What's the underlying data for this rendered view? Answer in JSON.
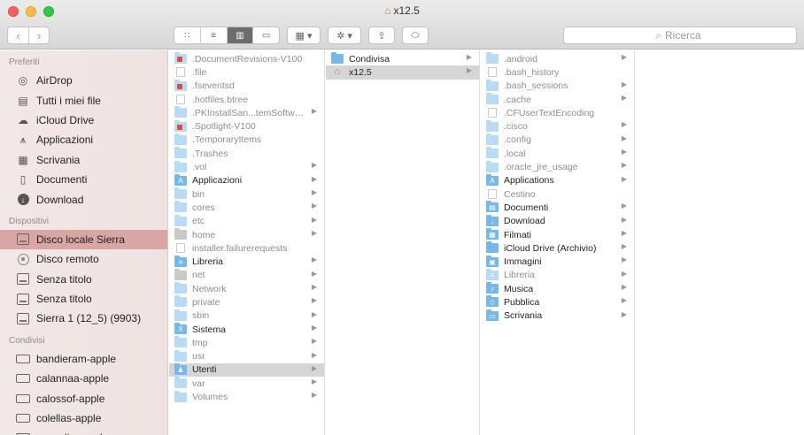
{
  "window": {
    "title": "x12.5",
    "title_icon": "home-icon"
  },
  "toolbar": {
    "back_glyph": "‹",
    "forward_glyph": "›",
    "view_icons": [
      "icon-view-icon",
      "list-view-icon",
      "column-view-icon",
      "cover-flow-icon"
    ],
    "arrange_glyph": "▦ ▾",
    "action_glyph": "✲ ▾",
    "share_glyph": "⇪",
    "tag_glyph": "⌂"
  },
  "search": {
    "placeholder": "Ricerca"
  },
  "sidebar": {
    "favorites_title": "Preferiti",
    "favorites": [
      {
        "label": "AirDrop",
        "icon": "airdrop-icon"
      },
      {
        "label": "Tutti i miei file",
        "icon": "all-files-icon"
      },
      {
        "label": "iCloud Drive",
        "icon": "cloud-icon"
      },
      {
        "label": "Applicazioni",
        "icon": "applications-icon"
      },
      {
        "label": "Scrivania",
        "icon": "desktop-icon"
      },
      {
        "label": "Documenti",
        "icon": "documents-icon"
      },
      {
        "label": "Download",
        "icon": "download-icon"
      }
    ],
    "devices_title": "Dispositivi",
    "devices": [
      {
        "label": "Disco locale Sierra",
        "icon": "disk-icon",
        "selected": true
      },
      {
        "label": "Disco remoto",
        "icon": "optical-disc-icon"
      },
      {
        "label": "Senza titolo",
        "icon": "disk-icon"
      },
      {
        "label": "Senza titolo",
        "icon": "disk-icon"
      },
      {
        "label": "Sierra 1 (12_5) (9903)",
        "icon": "disk-icon"
      }
    ],
    "shared_title": "Condivisi",
    "shared": [
      {
        "label": "bandieram-apple",
        "icon": "computer-icon"
      },
      {
        "label": "calannaa-apple",
        "icon": "computer-icon"
      },
      {
        "label": "calossof-apple",
        "icon": "computer-icon"
      },
      {
        "label": "colellas-apple",
        "icon": "computer-icon"
      },
      {
        "label": "cavaglier-apple",
        "icon": "computer-icon"
      }
    ]
  },
  "columns": {
    "root": [
      {
        "name": ".DocumentRevisions-V100",
        "kind": "badge-red",
        "hidden": true,
        "chev": false
      },
      {
        "name": ".file",
        "kind": "file",
        "hidden": true,
        "chev": false
      },
      {
        "name": ".fseventsd",
        "kind": "badge-red",
        "hidden": true,
        "chev": false
      },
      {
        "name": ".hotfiles.btree",
        "kind": "file",
        "hidden": true,
        "chev": false
      },
      {
        "name": ".PKInstallSan...temSoftware",
        "kind": "pale",
        "hidden": true,
        "chev": true
      },
      {
        "name": ".Spotlight-V100",
        "kind": "badge-red",
        "hidden": true,
        "chev": false
      },
      {
        "name": ".TemporaryItems",
        "kind": "pale",
        "hidden": true,
        "chev": false
      },
      {
        "name": ".Trashes",
        "kind": "pale",
        "hidden": true,
        "chev": false
      },
      {
        "name": ".vol",
        "kind": "pale",
        "hidden": true,
        "chev": true
      },
      {
        "name": "Applicazioni",
        "kind": "folder",
        "hidden": false,
        "chev": true,
        "glyph": "A"
      },
      {
        "name": "bin",
        "kind": "pale",
        "hidden": true,
        "chev": true
      },
      {
        "name": "cores",
        "kind": "pale",
        "hidden": true,
        "chev": true
      },
      {
        "name": "etc",
        "kind": "pale",
        "hidden": true,
        "chev": true
      },
      {
        "name": "home",
        "kind": "home",
        "hidden": true,
        "chev": true
      },
      {
        "name": "installer.failurerequests",
        "kind": "file",
        "hidden": true,
        "chev": false
      },
      {
        "name": "Libreria",
        "kind": "folder",
        "hidden": false,
        "chev": true,
        "glyph": "≡"
      },
      {
        "name": "net",
        "kind": "home",
        "hidden": true,
        "chev": true
      },
      {
        "name": "Network",
        "kind": "pale",
        "hidden": true,
        "chev": true
      },
      {
        "name": "private",
        "kind": "pale",
        "hidden": true,
        "chev": true
      },
      {
        "name": "sbin",
        "kind": "pale",
        "hidden": true,
        "chev": true
      },
      {
        "name": "Sistema",
        "kind": "folder",
        "hidden": false,
        "chev": true,
        "glyph": "X"
      },
      {
        "name": "tmp",
        "kind": "pale",
        "hidden": true,
        "chev": true
      },
      {
        "name": "usr",
        "kind": "pale",
        "hidden": true,
        "chev": true
      },
      {
        "name": "Utenti",
        "kind": "folder",
        "hidden": false,
        "chev": true,
        "glyph": "♟",
        "selected": true
      },
      {
        "name": "var",
        "kind": "pale",
        "hidden": true,
        "chev": true
      },
      {
        "name": "Volumes",
        "kind": "pale",
        "hidden": true,
        "chev": true
      }
    ],
    "users": [
      {
        "name": "Condivisa",
        "kind": "folder",
        "hidden": false,
        "chev": true
      },
      {
        "name": "x12.5",
        "kind": "homeglyph",
        "hidden": false,
        "chev": true,
        "selected": true
      }
    ],
    "home": [
      {
        "name": ".android",
        "kind": "pale",
        "hidden": true,
        "chev": true
      },
      {
        "name": ".bash_history",
        "kind": "file",
        "hidden": true,
        "chev": false
      },
      {
        "name": ".bash_sessions",
        "kind": "pale",
        "hidden": true,
        "chev": true
      },
      {
        "name": ".cache",
        "kind": "pale",
        "hidden": true,
        "chev": true
      },
      {
        "name": ".CFUserTextEncoding",
        "kind": "file",
        "hidden": true,
        "chev": false
      },
      {
        "name": ".cisco",
        "kind": "pale",
        "hidden": true,
        "chev": true
      },
      {
        "name": ".config",
        "kind": "pale",
        "hidden": true,
        "chev": true
      },
      {
        "name": ".local",
        "kind": "pale",
        "hidden": true,
        "chev": true
      },
      {
        "name": ".oracle_jre_usage",
        "kind": "pale",
        "hidden": true,
        "chev": true
      },
      {
        "name": "Applications",
        "kind": "folder",
        "hidden": false,
        "chev": true,
        "glyph": "A"
      },
      {
        "name": "Cestino",
        "kind": "file",
        "hidden": true,
        "chev": false
      },
      {
        "name": "Documenti",
        "kind": "folder",
        "hidden": false,
        "chev": true,
        "glyph": "▤"
      },
      {
        "name": "Download",
        "kind": "folder",
        "hidden": false,
        "chev": true,
        "glyph": "↓"
      },
      {
        "name": "Filmati",
        "kind": "folder",
        "hidden": false,
        "chev": true,
        "glyph": "▦"
      },
      {
        "name": "iCloud Drive (Archivio)",
        "kind": "folder",
        "hidden": false,
        "chev": true
      },
      {
        "name": "Immagini",
        "kind": "folder",
        "hidden": false,
        "chev": true,
        "glyph": "▣"
      },
      {
        "name": "Libreria",
        "kind": "pale",
        "hidden": true,
        "chev": true,
        "glyph": "≡"
      },
      {
        "name": "Musica",
        "kind": "folder",
        "hidden": false,
        "chev": true,
        "glyph": "♪"
      },
      {
        "name": "Pubblica",
        "kind": "folder",
        "hidden": false,
        "chev": true,
        "glyph": "◇"
      },
      {
        "name": "Scrivania",
        "kind": "folder",
        "hidden": false,
        "chev": true,
        "glyph": "▭"
      }
    ]
  }
}
